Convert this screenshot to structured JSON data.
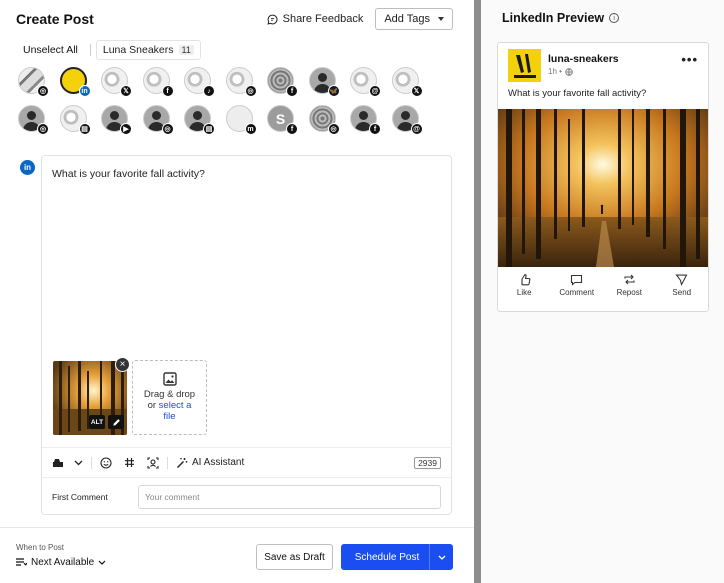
{
  "left": {
    "title": "Create Post",
    "share_feedback": "Share Feedback",
    "add_tags": "Add Tags",
    "unselect_all": "Unselect All",
    "group": {
      "name": "Luna Sneakers",
      "count": "11"
    },
    "avatars": [
      {
        "style": "sneaker",
        "badge": "instagram",
        "glyph": "◎",
        "selected": false
      },
      {
        "style": "yellow",
        "badge": "linkedin",
        "glyph": "in",
        "selected": true
      },
      {
        "style": "shoe",
        "badge": "x",
        "glyph": "𝕏",
        "selected": false
      },
      {
        "style": "shoe",
        "badge": "facebook",
        "glyph": "f",
        "selected": false
      },
      {
        "style": "shoe",
        "badge": "tiktok",
        "glyph": "♪",
        "selected": false
      },
      {
        "style": "shoe",
        "badge": "instagram",
        "glyph": "◎",
        "selected": false
      },
      {
        "style": "texture",
        "badge": "facebook",
        "glyph": "f",
        "selected": false
      },
      {
        "style": "person",
        "badge": "bluesky",
        "glyph": "🦋",
        "selected": false
      },
      {
        "style": "shoe",
        "badge": "threads",
        "glyph": "@",
        "selected": false
      },
      {
        "style": "shoe",
        "badge": "x",
        "glyph": "𝕏",
        "selected": false
      },
      {
        "style": "person",
        "badge": "instagram",
        "glyph": "◎",
        "selected": false
      },
      {
        "style": "shoe",
        "badge": "google-business",
        "glyph": "▤",
        "selected": false
      },
      {
        "style": "person",
        "badge": "youtube",
        "glyph": "▶",
        "selected": false
      },
      {
        "style": "person",
        "badge": "instagram",
        "glyph": "◎",
        "selected": false
      },
      {
        "style": "person",
        "badge": "google-business",
        "glyph": "▤",
        "selected": false
      },
      {
        "style": "cloud",
        "badge": "mastodon",
        "glyph": "m",
        "selected": false
      },
      {
        "style": "grey-s",
        "badge": "facebook",
        "glyph": "f",
        "selected": false,
        "letter": "S"
      },
      {
        "style": "texture",
        "badge": "instagram",
        "glyph": "◎",
        "selected": false
      },
      {
        "style": "person",
        "badge": "facebook",
        "glyph": "f",
        "selected": false
      },
      {
        "style": "person",
        "badge": "threads",
        "glyph": "@",
        "selected": false
      }
    ],
    "composer": {
      "text": "What is your favorite fall activity?",
      "alt_label": "ALT",
      "drop_line1": "Drag & drop",
      "drop_line2": "or",
      "drop_link1": "select a",
      "drop_link2": "file",
      "ai_assistant": "AI Assistant",
      "char_count": "2939",
      "first_comment_label": "First Comment",
      "first_comment_placeholder": "Your comment"
    },
    "footer": {
      "when_label": "When to Post",
      "when_value": "Next Available",
      "save_draft": "Save as Draft",
      "schedule": "Schedule Post"
    }
  },
  "right": {
    "title": "LinkedIn Preview",
    "card": {
      "name": "luna-sneakers",
      "meta": "1h •",
      "text": "What is your favorite fall activity?",
      "actions": [
        "Like",
        "Comment",
        "Repost",
        "Send"
      ]
    }
  },
  "colors": {
    "primary": "#1a4ef0",
    "linkedin": "#0a66c2",
    "divider": "#8d8d8d",
    "brand_yellow": "#f3d20b"
  }
}
